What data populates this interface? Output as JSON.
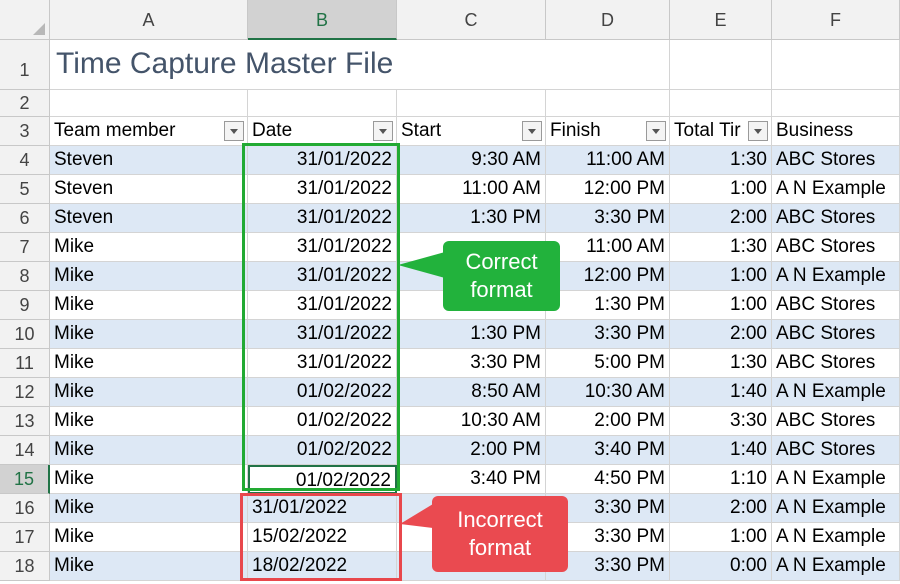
{
  "columns": [
    "A",
    "B",
    "C",
    "D",
    "E",
    "F"
  ],
  "selected_column": "B",
  "selected_row": 15,
  "title": "Time Capture Master File",
  "headers": [
    "Team member",
    "Date",
    "Start",
    "Finish",
    "Total Tir",
    "Business"
  ],
  "rows": [
    {
      "num": 4,
      "member": "Steven",
      "date": "31/01/2022",
      "start": "9:30 AM",
      "finish": "11:00 AM",
      "total": "1:30",
      "business": "ABC Stores"
    },
    {
      "num": 5,
      "member": "Steven",
      "date": "31/01/2022",
      "start": "11:00 AM",
      "finish": "12:00 PM",
      "total": "1:00",
      "business": "A N Example"
    },
    {
      "num": 6,
      "member": "Steven",
      "date": "31/01/2022",
      "start": "1:30 PM",
      "finish": "3:30 PM",
      "total": "2:00",
      "business": "ABC Stores"
    },
    {
      "num": 7,
      "member": "Mike",
      "date": "31/01/2022",
      "start": "",
      "finish": "11:00 AM",
      "total": "1:30",
      "business": "ABC Stores"
    },
    {
      "num": 8,
      "member": "Mike",
      "date": "31/01/2022",
      "start": "",
      "finish": "12:00 PM",
      "total": "1:00",
      "business": "A N Example"
    },
    {
      "num": 9,
      "member": "Mike",
      "date": "31/01/2022",
      "start": "",
      "finish": "1:30 PM",
      "total": "1:00",
      "business": "ABC Stores"
    },
    {
      "num": 10,
      "member": "Mike",
      "date": "31/01/2022",
      "start": "1:30 PM",
      "finish": "3:30 PM",
      "total": "2:00",
      "business": "ABC Stores"
    },
    {
      "num": 11,
      "member": "Mike",
      "date": "31/01/2022",
      "start": "3:30 PM",
      "finish": "5:00 PM",
      "total": "1:30",
      "business": "ABC Stores"
    },
    {
      "num": 12,
      "member": "Mike",
      "date": "01/02/2022",
      "start": "8:50 AM",
      "finish": "10:30 AM",
      "total": "1:40",
      "business": "A N Example"
    },
    {
      "num": 13,
      "member": "Mike",
      "date": "01/02/2022",
      "start": "10:30 AM",
      "finish": "2:00 PM",
      "total": "3:30",
      "business": "ABC Stores"
    },
    {
      "num": 14,
      "member": "Mike",
      "date": "01/02/2022",
      "start": "2:00 PM",
      "finish": "3:40 PM",
      "total": "1:40",
      "business": "ABC Stores"
    },
    {
      "num": 15,
      "member": "Mike",
      "date": "01/02/2022",
      "start": "3:40 PM",
      "finish": "4:50 PM",
      "total": "1:10",
      "business": "A N Example"
    },
    {
      "num": 16,
      "member": "Mike",
      "date": "31/01/2022",
      "start": "",
      "finish": "3:30 PM",
      "total": "2:00",
      "business": "A N Example",
      "text_date": true
    },
    {
      "num": 17,
      "member": "Mike",
      "date": "15/02/2022",
      "start": "",
      "finish": "3:30 PM",
      "total": "1:00",
      "business": "A N Example",
      "text_date": true
    },
    {
      "num": 18,
      "member": "Mike",
      "date": "18/02/2022",
      "start": "",
      "finish": "3:30 PM",
      "total": "0:00",
      "business": "A N Example",
      "text_date": true
    }
  ],
  "callouts": {
    "correct": "Correct\nformat",
    "incorrect": "Incorrect\nformat"
  },
  "colors": {
    "band": "#dde8f5",
    "correct": "#22aa33",
    "incorrect": "#e8474c",
    "accent": "#217346"
  }
}
